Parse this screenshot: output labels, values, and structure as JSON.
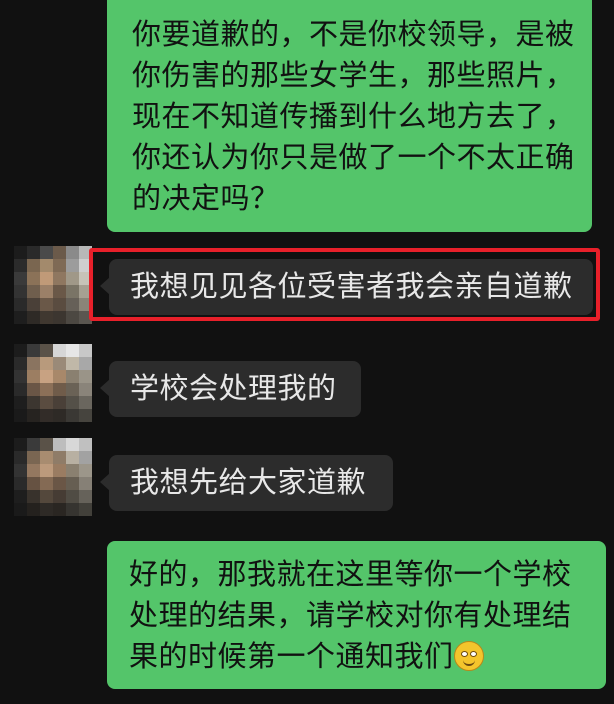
{
  "messages": [
    {
      "from": "me",
      "lines": [
        "你要道歉的，不是你校领导，是被",
        "你伤害的那些女学生，那些照片，",
        "现在不知道传播到什么地方去了，",
        "你还认为你只是做了一个不太正确",
        "的决定吗？"
      ]
    },
    {
      "from": "other",
      "text": "我想见见各位受害者我会亲自道歉",
      "highlighted": true
    },
    {
      "from": "other",
      "text": "学校会处理我的"
    },
    {
      "from": "other",
      "text": "我想先给大家道歉"
    },
    {
      "from": "me",
      "lines": [
        "好的，那我就在这里等你一个学校",
        "处理的结果，请学校对你有处理结",
        "果的时候第一个通知我们"
      ],
      "emoji": "smiling-face-emoji"
    }
  ],
  "colors": {
    "background": "#111111",
    "outgoing_bubble": "#54c56a",
    "incoming_bubble": "#2c2c2c",
    "highlight_box": "#e8202a"
  },
  "avatar_style": "pixelated"
}
